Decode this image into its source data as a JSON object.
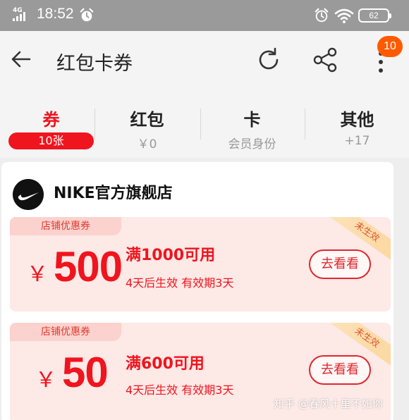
{
  "status_bar": {
    "network": "4G",
    "time": "18:52",
    "battery": "62"
  },
  "nav": {
    "title": "红包卡券",
    "badge_count": "10",
    "icons": [
      "back-arrow-icon",
      "refresh-icon",
      "share-icon",
      "more-icon"
    ]
  },
  "tabs": [
    {
      "label": "券",
      "sub": "10张",
      "active": true
    },
    {
      "label": "红包",
      "sub": "￥0",
      "active": false
    },
    {
      "label": "卡",
      "sub": "会员身份",
      "active": false
    },
    {
      "label": "其他",
      "sub": "+17",
      "active": false
    }
  ],
  "store": {
    "name": "NIKE官方旗舰店",
    "logo": "nike-swoosh-icon"
  },
  "coupons": [
    {
      "tag": "店铺优惠券",
      "currency": "￥",
      "amount": "500",
      "condition": "满1000可用",
      "validity": "4天后生效 有效期3天",
      "button": "去看看",
      "status": "未生效"
    },
    {
      "tag": "店铺优惠券",
      "currency": "￥",
      "amount": "50",
      "condition": "满600可用",
      "validity": "4天后生效 有效期3天",
      "button": "去看看",
      "status": "未生效"
    }
  ],
  "watermark": "知乎 @春风十里不如你",
  "colors": {
    "accent": "#f0141e",
    "badge": "#ff5a00",
    "status_bar": "#9a9a9a"
  }
}
